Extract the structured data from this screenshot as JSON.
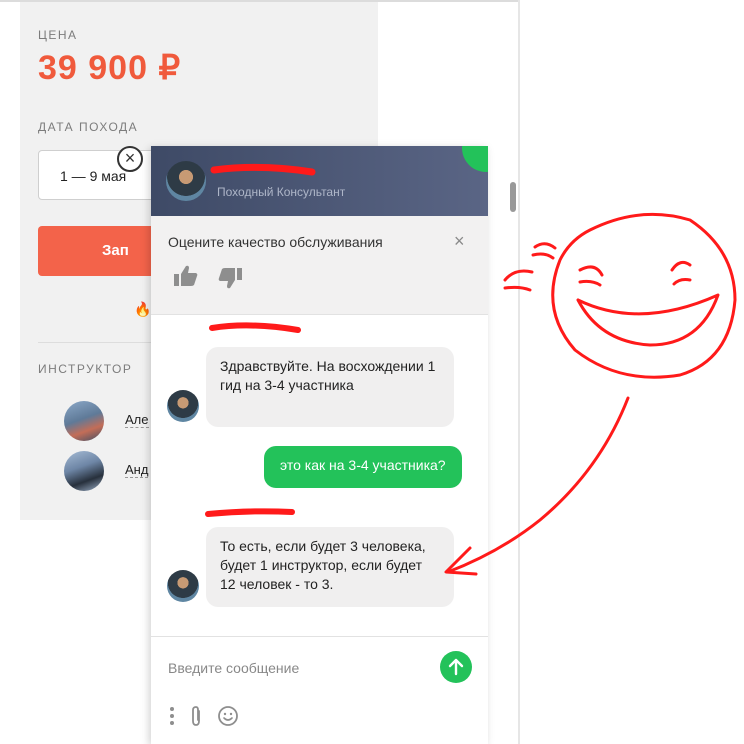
{
  "booking": {
    "price_label": "ЦЕНА",
    "price": "39 900 ₽",
    "date_label": "ДАТА ПОХОДА",
    "date_value": "1 — 9 мая",
    "book_button": "Зап",
    "instructors_label": "ИНСТРУКТОР",
    "instructors": [
      {
        "name": "Але"
      },
      {
        "name": "Анд"
      }
    ]
  },
  "chat": {
    "agent_name": "",
    "agent_role": "Походный Консультант",
    "rating": {
      "title": "Оцените качество обслуживания",
      "close": "×"
    },
    "messages": [
      {
        "from": "agent",
        "text": "Здравствуйте. На восхождении 1 гид на 3-4 участника"
      },
      {
        "from": "user",
        "text": "это как на 3-4 участника?"
      },
      {
        "from": "agent",
        "text": "То есть, если будет 3 человека, будет 1 инструктор, если будет 12 человек - то 3."
      }
    ],
    "input_placeholder": "Введите сообщение"
  },
  "colors": {
    "accent_green": "#23c25a",
    "price_red": "#f05a3c",
    "header_bg": "#4a5575",
    "annotation_red": "#ff1a1a"
  },
  "icons": [
    "close-circle-icon",
    "thumbs-up-icon",
    "thumbs-down-icon",
    "close-icon",
    "send-arrow-icon",
    "more-vertical-icon",
    "paperclip-icon",
    "emoji-icon",
    "fire-icon"
  ]
}
